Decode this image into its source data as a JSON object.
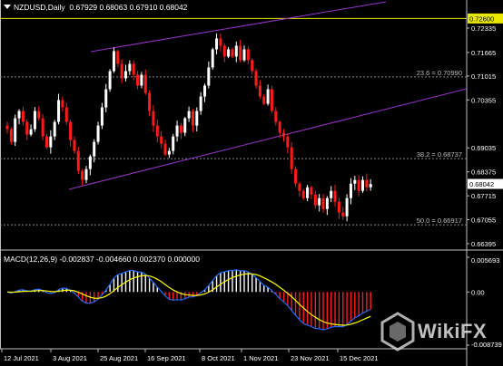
{
  "header": {
    "symbol_timeframe": "NZDUSD,Daily",
    "ohlc": "0.67929 0.68063 0.67910 0.68042"
  },
  "price_axis": {
    "ticks": [
      "0.72335",
      "0.71665",
      "0.71015",
      "0.70355",
      "0.69035",
      "0.68375",
      "0.67715",
      "0.67055",
      "0.66395"
    ],
    "price_labels": {
      "top": "0.72600",
      "current": "0.68042"
    }
  },
  "fib_levels": [
    {
      "label": "23.6 = 0.70990",
      "price": 0.7099
    },
    {
      "label": "38.2 = 0.68737",
      "price": 0.68737
    },
    {
      "label": "50.0 = 0.66917",
      "price": 0.66917
    }
  ],
  "macd": {
    "label": "MACD(12,26,9) -0.002837 -0.004660 0.002370 0.000000",
    "axis_ticks": [
      "0.005693",
      "0.00",
      "-0.008739"
    ]
  },
  "time_axis": {
    "labels": [
      "12 Jul 2021",
      "3 Aug 2021",
      "25 Aug 2021",
      "16 Sep 2021",
      "8 Oct 2021",
      "1 Nov 2021",
      "23 Nov 2021",
      "15 Dec 2021"
    ]
  },
  "watermark": {
    "text": "WikiFX"
  },
  "colors": {
    "background": "#000000",
    "bull_candle": "#ffffff",
    "bear_candle": "#ff1a1a",
    "channel": "#9932cc",
    "fib_line": "#8a8a8a",
    "resistance": "#e8e800",
    "macd_line": "#1e6bff",
    "signal_line": "#ffff00",
    "hist_pos": "#ffffff",
    "hist_neg": "#ff1a1a"
  },
  "chart_data": {
    "type": "candlestick",
    "symbol": "NZDUSD",
    "timeframe": "Daily",
    "last_ohlc": {
      "open": 0.67929,
      "high": 0.68063,
      "low": 0.6791,
      "close": 0.68042
    },
    "resistance_level": 0.726,
    "fibonacci": [
      {
        "ratio": 23.6,
        "price": 0.7099
      },
      {
        "ratio": 38.2,
        "price": 0.68737
      },
      {
        "ratio": 50.0,
        "price": 0.66917
      }
    ],
    "ylim": [
      0.66395,
      0.72335
    ],
    "macd_params": [
      12,
      26,
      9
    ],
    "macd_values": {
      "main": -0.002837,
      "signal": -0.00466,
      "osma": 0.00237,
      "extra": 0.0
    },
    "macd_ylim": [
      -0.008739,
      0.005693
    ],
    "x_labels": [
      "12 Jul 2021",
      "3 Aug 2021",
      "25 Aug 2021",
      "16 Sep 2021",
      "8 Oct 2021",
      "1 Nov 2021",
      "23 Nov 2021",
      "15 Dec 2021"
    ],
    "close_path": [
      0.6955,
      0.692,
      0.6985,
      0.7005,
      0.6975,
      0.694,
      0.6955,
      0.7005,
      0.6985,
      0.6935,
      0.6905,
      0.6935,
      0.6975,
      0.7035,
      0.7015,
      0.6975,
      0.6925,
      0.6895,
      0.684,
      0.6815,
      0.6845,
      0.688,
      0.692,
      0.6965,
      0.7015,
      0.7065,
      0.7115,
      0.717,
      0.7135,
      0.7095,
      0.7115,
      0.7135,
      0.7105,
      0.7075,
      0.7105,
      0.7055,
      0.7005,
      0.6965,
      0.6935,
      0.6915,
      0.6885,
      0.6895,
      0.6935,
      0.6965,
      0.6945,
      0.6985,
      0.7005,
      0.6965,
      0.7005,
      0.7045,
      0.7075,
      0.7125,
      0.7175,
      0.7205,
      0.7185,
      0.7155,
      0.7175,
      0.7155,
      0.7185,
      0.7145,
      0.7175,
      0.7145,
      0.7115,
      0.7075,
      0.7045,
      0.7025,
      0.7065,
      0.7005,
      0.6975,
      0.6945,
      0.6935,
      0.6905,
      0.6845,
      0.6805,
      0.6785,
      0.6765,
      0.6795,
      0.6775,
      0.6745,
      0.6765,
      0.6735,
      0.6765,
      0.6785,
      0.6755,
      0.6725,
      0.6715,
      0.6765,
      0.6805,
      0.6815,
      0.6785,
      0.6815,
      0.6795,
      0.6804
    ]
  }
}
